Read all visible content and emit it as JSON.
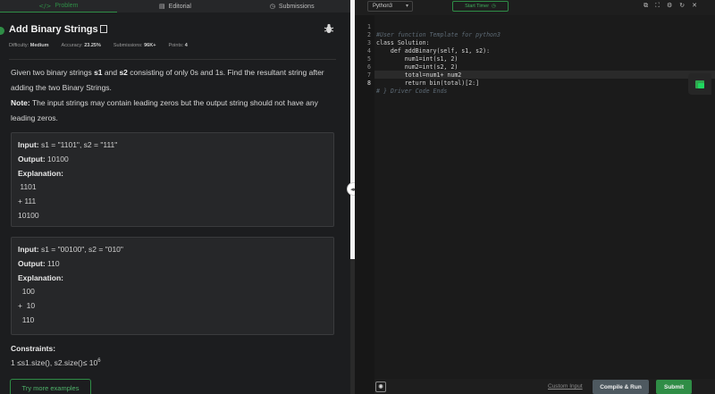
{
  "tabs": [
    {
      "label": "Problem",
      "icon": "code-icon"
    },
    {
      "label": "Editorial",
      "icon": "book-icon"
    },
    {
      "label": "Submissions",
      "icon": "clock-icon"
    }
  ],
  "problem": {
    "title": "Add Binary Strings",
    "meta": {
      "difficulty_label": "Difficulty:",
      "difficulty": "Medium",
      "accuracy_label": "Accuracy:",
      "accuracy": "23.25%",
      "submissions_label": "Submissions:",
      "submissions": "96K+",
      "points_label": "Points:",
      "points": "4"
    },
    "desc": {
      "p1_a": "Given two binary strings ",
      "s1": "s1",
      "p1_b": " and ",
      "s2": "s2",
      "p1_c": " consisting of only 0s and 1s. Find the resultant string after adding the two Binary Strings.",
      "note_label": "Note:",
      "note_text": " The input strings may contain leading zeros but the output string should not have any leading zeros."
    },
    "examples": [
      {
        "input_label": "Input:",
        "input": " s1 = \"1101\", s2 = \"111\"",
        "output_label": "Output:",
        "output": " 10100",
        "explanation_label": "Explanation:",
        "lines": [
          " 1101",
          "+ 111",
          "10100"
        ]
      },
      {
        "input_label": "Input:",
        "input": " s1 = \"00100\", s2 = \"010\"",
        "output_label": "Output:",
        "output": " 110",
        "explanation_label": "Explanation:",
        "lines": [
          "  100",
          "+  10",
          "  110"
        ]
      }
    ],
    "constraints_label": "Constraints:",
    "constraints_text": "1 ≤s1.size(), s2.size()≤ 10",
    "constraints_exp": "6",
    "try_more": "Try more examples"
  },
  "editor": {
    "language": "Python3",
    "timer": "Start Timer",
    "lines": [
      {
        "n": "1",
        "text": "#User function Template for python3"
      },
      {
        "n": "2",
        "text": "class Solution:"
      },
      {
        "n": "3",
        "text": "    def addBinary(self, s1, s2):"
      },
      {
        "n": "4",
        "text": "        num1=int(s1, 2)"
      },
      {
        "n": "5",
        "text": "        num2=int(s2, 2)"
      },
      {
        "n": "6",
        "text": "        total=num1+ num2"
      },
      {
        "n": "7",
        "text": "        return bin(total)[2:]"
      },
      {
        "n": "8",
        "text": "# } Driver Code Ends"
      }
    ]
  },
  "footer": {
    "custom_input": "Custom Input",
    "compile": "Compile & Run",
    "submit": "Submit"
  },
  "colors": {
    "accent": "#2f8d46",
    "background": "#1e1e1e"
  }
}
